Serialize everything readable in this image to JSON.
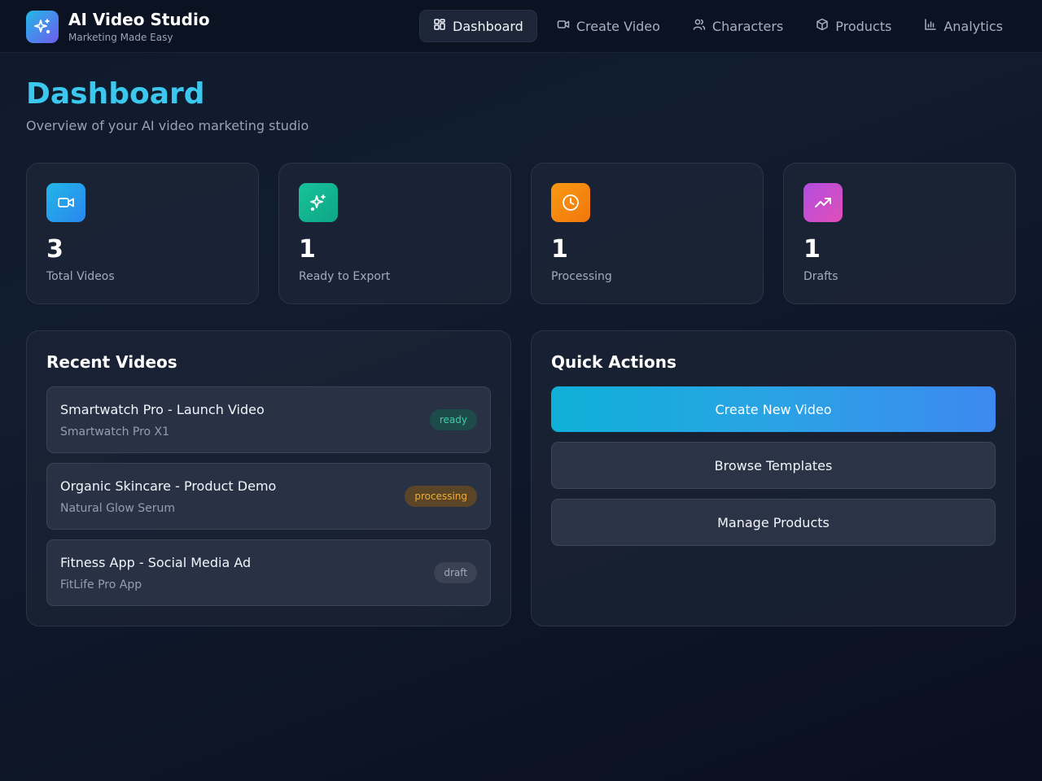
{
  "app": {
    "title": "AI Video Studio",
    "subtitle": "Marketing Made Easy",
    "logo_icon": "sparkles-icon"
  },
  "nav": {
    "items": [
      {
        "label": "Dashboard",
        "icon": "layout-grid-icon",
        "active": true
      },
      {
        "label": "Create Video",
        "icon": "video-camera-icon",
        "active": false
      },
      {
        "label": "Characters",
        "icon": "users-icon",
        "active": false
      },
      {
        "label": "Products",
        "icon": "package-icon",
        "active": false
      },
      {
        "label": "Analytics",
        "icon": "bar-chart-icon",
        "active": false
      }
    ]
  },
  "page": {
    "title": "Dashboard",
    "subtitle": "Overview of your AI video marketing studio"
  },
  "stats": [
    {
      "value": "3",
      "label": "Total Videos",
      "icon": "video-camera-icon",
      "color": "#1ea8e8"
    },
    {
      "value": "1",
      "label": "Ready to Export",
      "icon": "sparkles-icon",
      "color": "#12b48f"
    },
    {
      "value": "1",
      "label": "Processing",
      "icon": "clock-icon",
      "color": "#f5850f"
    },
    {
      "value": "1",
      "label": "Drafts",
      "icon": "trending-up-icon",
      "color": "#c44fd8"
    }
  ],
  "recent": {
    "title": "Recent Videos",
    "videos": [
      {
        "title": "Smartwatch Pro - Launch Video",
        "product": "Smartwatch Pro X1",
        "status": "ready"
      },
      {
        "title": "Organic Skincare - Product Demo",
        "product": "Natural Glow Serum",
        "status": "processing"
      },
      {
        "title": "Fitness App - Social Media Ad",
        "product": "FitLife Pro App",
        "status": "draft"
      }
    ]
  },
  "quick_actions": {
    "title": "Quick Actions",
    "create_label": "Create New Video",
    "templates_label": "Browse Templates",
    "products_label": "Manage Products"
  },
  "colors": {
    "accent_title": "#3cc8ee",
    "background": "#0f1a2c",
    "status_ready": "#3ed0a4",
    "status_processing": "#f0ac36",
    "status_draft": "#a3abbc"
  }
}
